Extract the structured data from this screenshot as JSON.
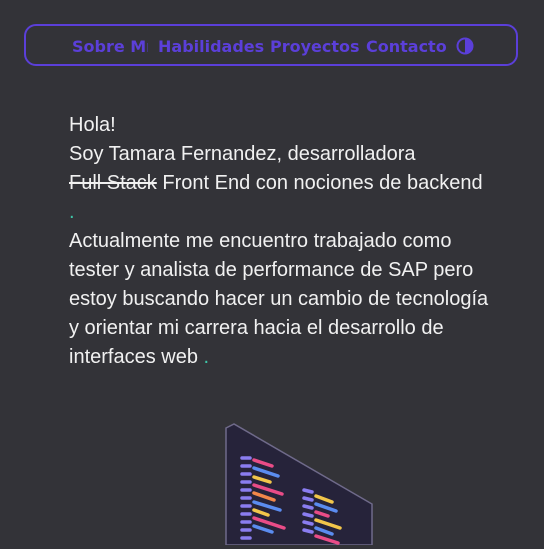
{
  "nav": {
    "links": [
      "Sobre Mí",
      "Habilidades",
      "Proyectos",
      "Contacto"
    ],
    "theme_toggle_icon": "contrast-icon"
  },
  "intro": {
    "greeting": "Hola!",
    "line1_prefix": "Soy Tamara Fernandez, desarrolladora",
    "struck": "Full Stack",
    "line1_suffix": " Front End con nociones de backend",
    "dot1": ".",
    "paragraph2": "Actualmente me encuentro trabajado como tester y analista de performance de SAP pero estoy buscando hacer un cambio de tecnología y orientar mi carrera hacia el desarrollo de interfaces web",
    "dot2": "."
  },
  "colors": {
    "background": "#333338",
    "accent": "#5b3fd9",
    "text": "#f1f1f1",
    "dot": "#3ec6a8"
  },
  "illustration": "laptop-code-illustration"
}
